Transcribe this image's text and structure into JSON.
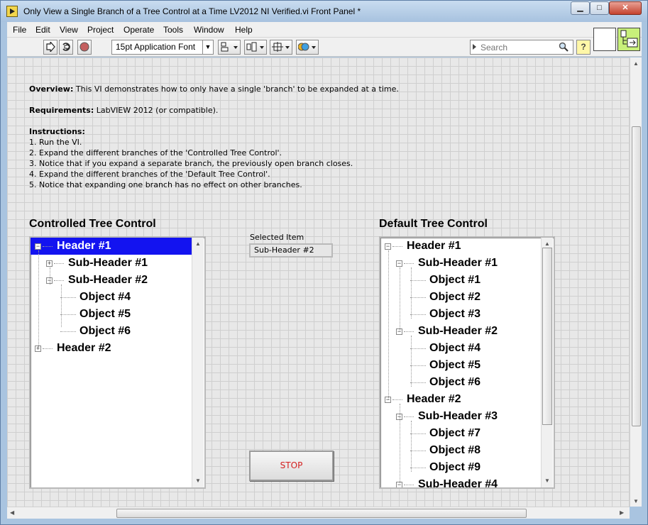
{
  "window": {
    "title": "Only View a Single Branch of a Tree Control at a Time LV2012 NI Verified.vi Front Panel *",
    "minimize_glyph": "▁",
    "maximize_glyph": "□",
    "close_glyph": "✕"
  },
  "menu": [
    "File",
    "Edit",
    "View",
    "Project",
    "Operate",
    "Tools",
    "Window",
    "Help"
  ],
  "toolbar": {
    "font_select": "15pt Application Font",
    "search_placeholder": "Search",
    "help_glyph": "?",
    "icons": [
      "run-arrow-icon",
      "run-continuously-icon",
      "abort-icon",
      "align-objects-icon",
      "distribute-objects-icon",
      "resize-objects-icon",
      "reorder-icon"
    ]
  },
  "overview": {
    "overview_label": "Overview:",
    "overview_text": " This VI demonstrates how to only have a single 'branch' to be expanded at a time.",
    "requirements_label": "Requirements:",
    "requirements_text": " LabVIEW 2012 (or compatible).",
    "instructions_label": "Instructions:",
    "steps": [
      "1. Run the VI.",
      "2. Expand the different branches of the 'Controlled Tree Control'.",
      "3. Notice that if you expand a separate branch, the previously open branch closes.",
      "4. Expand the different branches of the 'Default Tree Control'.",
      "5. Notice that expanding one branch has no effect on other branches."
    ]
  },
  "controlled_tree": {
    "label": "Controlled Tree Control",
    "rows": [
      {
        "text": "Header #1",
        "level": 0,
        "expander": "−",
        "selected": true
      },
      {
        "text": "Sub-Header #1",
        "level": 1,
        "expander": "+"
      },
      {
        "text": "Sub-Header #2",
        "level": 1,
        "expander": "−"
      },
      {
        "text": "Object #4",
        "level": 2
      },
      {
        "text": "Object #5",
        "level": 2
      },
      {
        "text": "Object #6",
        "level": 2
      },
      {
        "text": "Header #2",
        "level": 0,
        "expander": "+"
      }
    ]
  },
  "selected_item": {
    "label": "Selected Item",
    "value": "Sub-Header #2"
  },
  "stop_button": {
    "label": "STOP",
    "color": "#d42020"
  },
  "default_tree": {
    "label": "Default Tree Control",
    "rows": [
      {
        "text": "Header #1",
        "level": 0,
        "expander": "−"
      },
      {
        "text": "Sub-Header #1",
        "level": 1,
        "expander": "−"
      },
      {
        "text": "Object #1",
        "level": 2
      },
      {
        "text": "Object #2",
        "level": 2
      },
      {
        "text": "Object #3",
        "level": 2
      },
      {
        "text": "Sub-Header #2",
        "level": 1,
        "expander": "−"
      },
      {
        "text": "Object #4",
        "level": 2
      },
      {
        "text": "Object #5",
        "level": 2
      },
      {
        "text": "Object #6",
        "level": 2
      },
      {
        "text": "Header #2",
        "level": 0,
        "expander": "−"
      },
      {
        "text": "Sub-Header #3",
        "level": 1,
        "expander": "−"
      },
      {
        "text": "Object #7",
        "level": 2
      },
      {
        "text": "Object #8",
        "level": 2
      },
      {
        "text": "Object #9",
        "level": 2
      },
      {
        "text": "Sub-Header #4",
        "level": 1,
        "expander": "−"
      }
    ]
  },
  "colors": {
    "selection": "#1313f0",
    "panel_grid_bg": "#e8e8e8"
  }
}
